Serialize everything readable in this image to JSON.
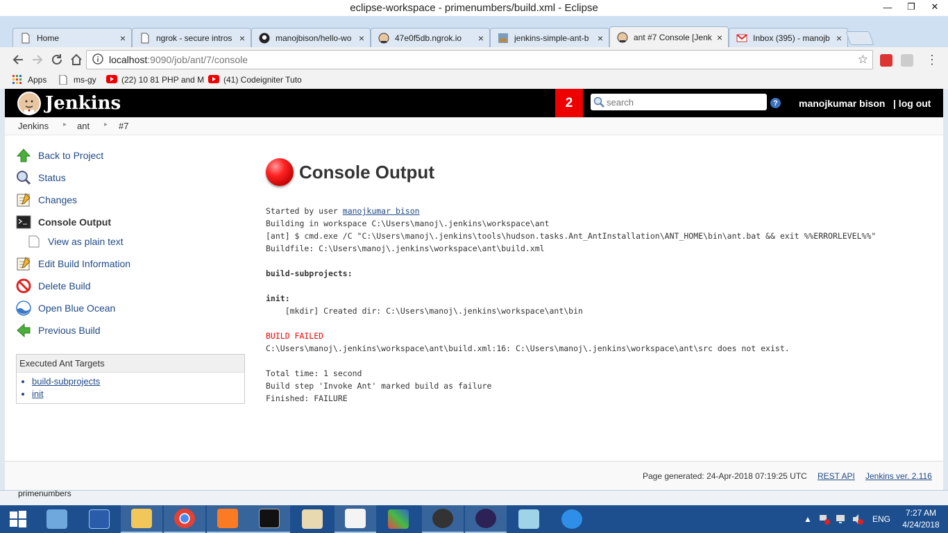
{
  "window": {
    "title": "eclipse-workspace - primenumbers/build.xml - Eclipse",
    "controls": {
      "minimize": "—",
      "maximize": "❐",
      "close": "✕"
    }
  },
  "browser": {
    "tabs": [
      {
        "label": "Home",
        "icon": "document-icon"
      },
      {
        "label": "ngrok - secure intros",
        "icon": "document-icon"
      },
      {
        "label": "manojbison/hello-wo",
        "icon": "github-icon"
      },
      {
        "label": "47e0f5db.ngrok.io",
        "icon": "jenkins-icon"
      },
      {
        "label": "jenkins-simple-ant-b",
        "icon": "image-icon"
      },
      {
        "label": "ant #7 Console [Jenk",
        "icon": "jenkins-icon",
        "active": true
      },
      {
        "label": "Inbox (395) - manojb",
        "icon": "gmail-icon"
      }
    ],
    "tab_close": "×",
    "url_host": "localhost",
    "url_path": ":9090/job/ant/7/console",
    "bookmarks": [
      {
        "label": "Apps",
        "icon": "apps-grid-icon"
      },
      {
        "label": "ms-gy",
        "icon": "document-icon"
      },
      {
        "label": "(22) 10 81 PHP and M",
        "icon": "youtube-icon"
      },
      {
        "label": "(41) Codeigniter Tuto",
        "icon": "youtube-icon"
      }
    ]
  },
  "jenkins": {
    "title": "Jenkins",
    "notification_count": "2",
    "search_placeholder": "search",
    "user": "manojkumar bison",
    "logout": "| log out",
    "breadcrumb": [
      "Jenkins",
      "ant",
      "#7"
    ],
    "sidebar": [
      {
        "label": "Back to Project",
        "icon": "up-arrow-icon"
      },
      {
        "label": "Status",
        "icon": "magnifier-icon"
      },
      {
        "label": "Changes",
        "icon": "notepad-icon"
      },
      {
        "label": "Console Output",
        "icon": "terminal-icon",
        "current": true
      },
      {
        "label": "View as plain text",
        "icon": "document-icon",
        "sub": true
      },
      {
        "label": "Edit Build Information",
        "icon": "notepad-icon"
      },
      {
        "label": "Delete Build",
        "icon": "no-entry-icon"
      },
      {
        "label": "Open Blue Ocean",
        "icon": "blue-ocean-icon"
      },
      {
        "label": "Previous Build",
        "icon": "left-arrow-icon"
      }
    ],
    "executed_targets": {
      "header": "Executed Ant Targets",
      "items": [
        "build-subprojects",
        "init"
      ]
    },
    "main_title": "Console Output",
    "console": {
      "started_prefix": "Started by user ",
      "started_user": "manojkumar bison",
      "line_workspace": "Building in workspace C:\\Users\\manoj\\.jenkins\\workspace\\ant",
      "line_cmd": "[ant] $ cmd.exe /C \"C:\\Users\\manoj\\.jenkins\\tools\\hudson.tasks.Ant_AntInstallation\\ANT_HOME\\bin\\ant.bat && exit %%ERRORLEVEL%%\"",
      "line_buildfile": "Buildfile: C:\\Users\\manoj\\.jenkins\\workspace\\ant\\build.xml",
      "target_subprojects": "build-subprojects:",
      "target_init": "init:",
      "line_mkdir": "    [mkdir] Created dir: C:\\Users\\manoj\\.jenkins\\workspace\\ant\\bin",
      "build_failed": "BUILD FAILED",
      "line_error": "C:\\Users\\manoj\\.jenkins\\workspace\\ant\\build.xml:16: C:\\Users\\manoj\\.jenkins\\workspace\\ant\\src does not exist.",
      "line_time": "Total time: 1 second",
      "line_step": "Build step 'Invoke Ant' marked build as failure",
      "line_finished": "Finished: FAILURE"
    },
    "footer": {
      "generated": "Page generated: 24-Apr-2018 07:19:25 UTC",
      "rest_api": "REST API",
      "version": "Jenkins ver. 2.116"
    }
  },
  "eclipse_peek": "primenumbers",
  "taskbar": {
    "language": "ENG",
    "time": "7:27 AM",
    "date": "4/24/2018",
    "apps": [
      "file-explorer-icon",
      "powershell-icon",
      "folder-icon",
      "chrome-icon",
      "xampp-icon",
      "cmd-icon",
      "paint-icon",
      "notepad-icon",
      "uipath-icon",
      "obs-icon",
      "eclipse-icon",
      "glass-icon",
      "ie-icon"
    ]
  },
  "colors": {
    "jenkins_header": "#000000",
    "badge": "#ee0000",
    "link": "#204a87",
    "failure": "#ee0000",
    "taskbar": "#1d4f8f"
  }
}
